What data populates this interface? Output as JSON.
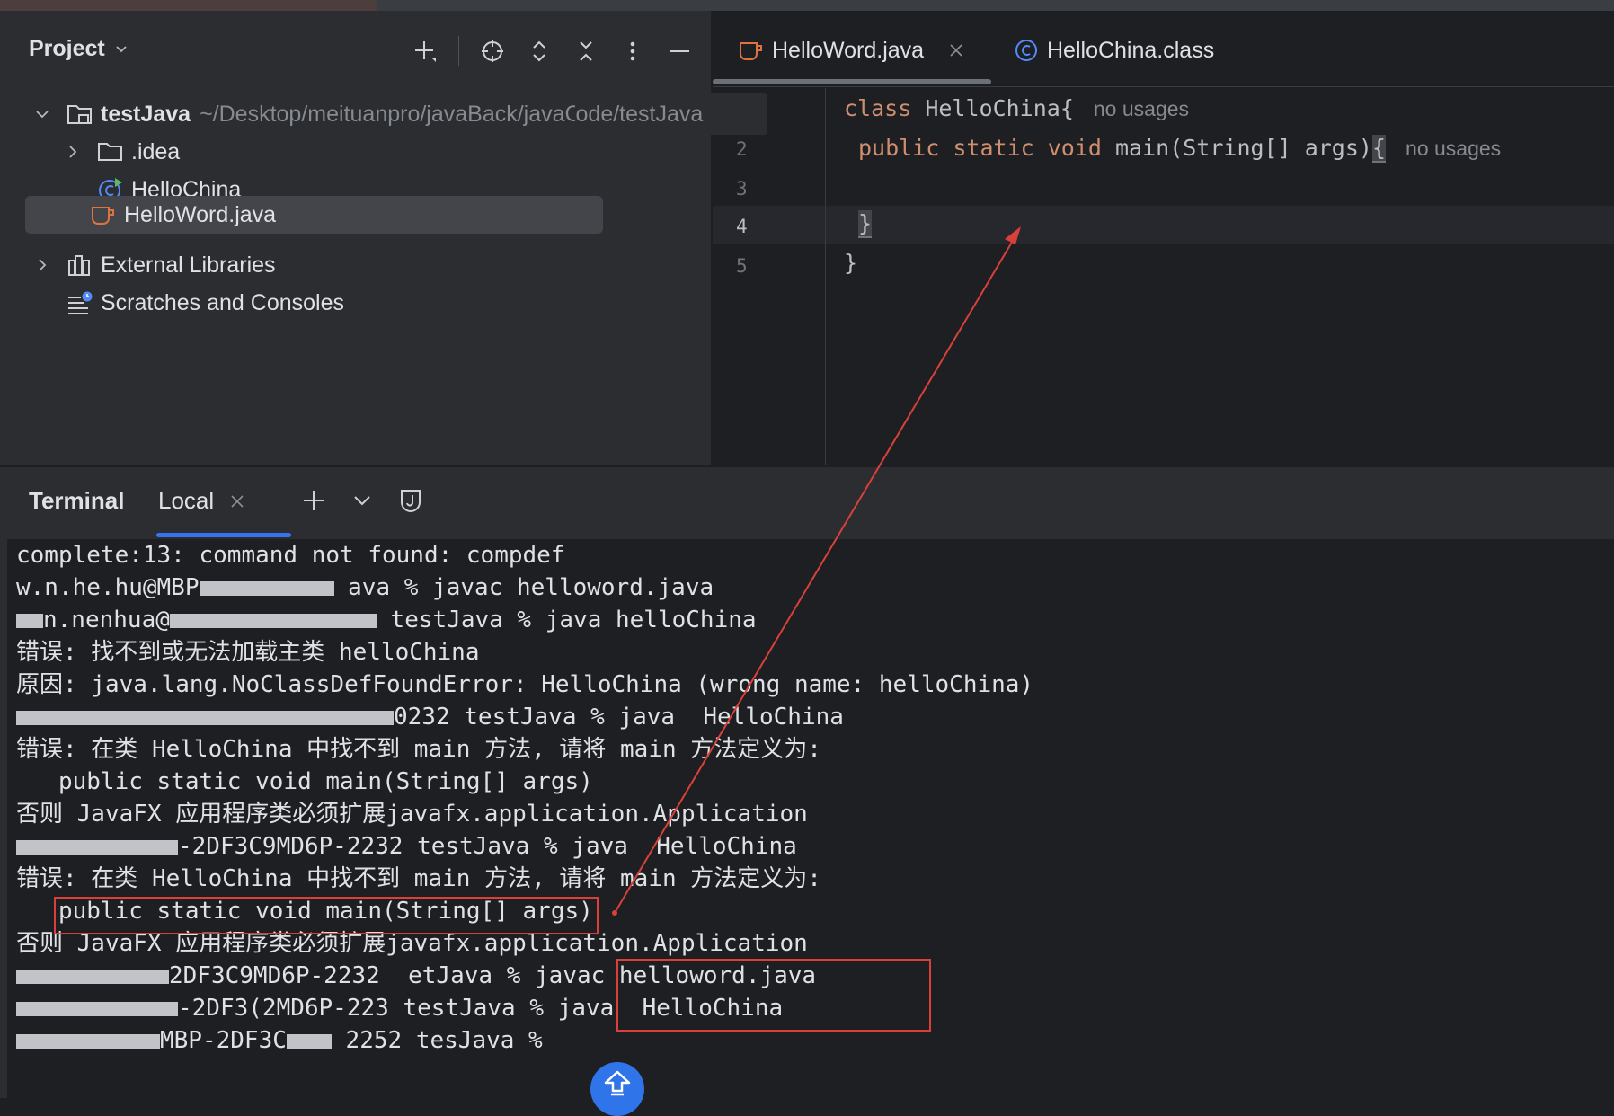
{
  "project_panel": {
    "title": "Project",
    "tree": [
      {
        "label": "testJava",
        "path": "~/Desktop/meituanpro/javaBack/javaCode/testJava"
      },
      {
        "label": ".idea"
      },
      {
        "label": "HelloChina"
      },
      {
        "label": "HelloWord.java",
        "selected": true
      },
      {
        "label": "External Libraries"
      },
      {
        "label": "Scratches and Consoles"
      }
    ]
  },
  "editor": {
    "tabs": [
      {
        "label": "HelloWord.java",
        "active": true
      },
      {
        "label": "HelloChina.class",
        "active": false
      }
    ],
    "line_numbers": [
      "2",
      "3",
      "4",
      "5"
    ],
    "code": {
      "line1_kw": "class",
      "line1_rest": " HelloChina{",
      "line1_hint": "no usages",
      "line2_kw": "public static void",
      "line2_rest": " main(String[] args)",
      "line2_brace": "{",
      "line2_hint": "no usages",
      "line4": "}",
      "line5": "}"
    }
  },
  "terminal": {
    "title": "Terminal",
    "tab_label": "Local",
    "lines": [
      "complete:13: command not found: compdef",
      "ava % javac helloword.java",
      "testJava % java helloChina",
      "错误: 找不到或无法加载主类 helloChina",
      "原因: java.lang.NoClassDefFoundError: HelloChina (wrong name: helloChina)",
      "0232 testJava % java  HelloChina",
      "错误: 在类 HelloChina 中找不到 main 方法, 请将 main 方法定义为:",
      "   public static void main(String[] args)",
      "否则 JavaFX 应用程序类必须扩展javafx.application.Application",
      "testJava % java  HelloChina",
      "错误: 在类 HelloChina 中找不到 main 方法, 请将 main 方法定义为:",
      "   public static void main(String[] args)",
      "否则 JavaFX 应用程序类必须扩展javafx.application.Application",
      "javac helloword.java",
      "java  HelloChina",
      "tesJava %"
    ],
    "visible_fragments": {
      "line2_prefix": "w.n.he.hu@MBP",
      "line3_prefix": "n.nenhua@",
      "line10_host": "-2DF3C9MD6P-2232",
      "line14_host": "2DF3C9MD6P-2232",
      "line14_dir": "etJava %",
      "line15_host": "-2DF3(2MD6P-223",
      "line15_dir": "testJava %",
      "line16_host": "MBP-2DF3C",
      "line16_suffix": "2252"
    }
  },
  "colors": {
    "keyword": "#cf8e6d",
    "annotation": "#d9403a",
    "accent": "#3574f0"
  }
}
